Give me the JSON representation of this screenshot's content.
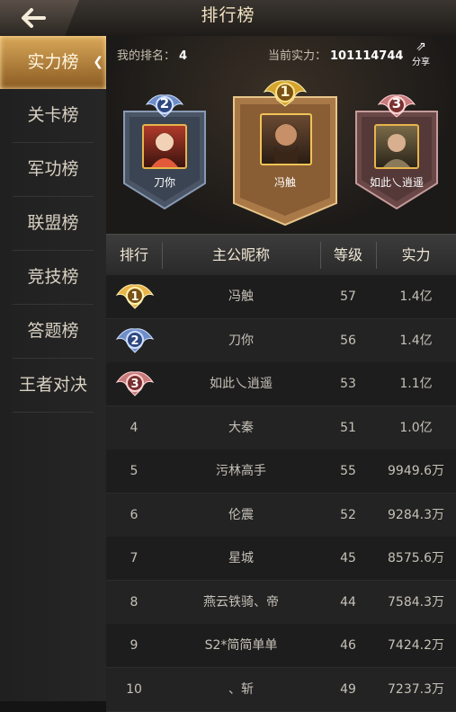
{
  "header": {
    "title": "排行榜"
  },
  "sidebar": {
    "items": [
      {
        "label": "实力榜",
        "active": true
      },
      {
        "label": "关卡榜",
        "active": false
      },
      {
        "label": "军功榜",
        "active": false
      },
      {
        "label": "联盟榜",
        "active": false
      },
      {
        "label": "竞技榜",
        "active": false
      },
      {
        "label": "答题榜",
        "active": false
      },
      {
        "label": "王者对决",
        "active": false
      }
    ]
  },
  "summary": {
    "my_rank_label": "我的排名：",
    "my_rank_value": "4",
    "power_label": "当前实力：",
    "power_value": "101114744",
    "share_label": "分享"
  },
  "podium": {
    "first": {
      "rank": "1",
      "name": "冯触"
    },
    "second": {
      "rank": "2",
      "name": "刀你"
    },
    "third": {
      "rank": "3",
      "name": "如此乀逍遥"
    }
  },
  "table": {
    "headers": {
      "rank": "排行",
      "name": "主公昵称",
      "level": "等级",
      "power": "实力"
    },
    "rows": [
      {
        "rank": "1",
        "name": "冯触",
        "level": "57",
        "power": "1.4亿"
      },
      {
        "rank": "2",
        "name": "刀你",
        "level": "56",
        "power": "1.4亿"
      },
      {
        "rank": "3",
        "name": "如此乀逍遥",
        "level": "53",
        "power": "1.1亿"
      },
      {
        "rank": "4",
        "name": "大秦",
        "level": "51",
        "power": "1.0亿"
      },
      {
        "rank": "5",
        "name": "污林高手",
        "level": "55",
        "power": "9949.6万"
      },
      {
        "rank": "6",
        "name": "伦震",
        "level": "52",
        "power": "9284.3万"
      },
      {
        "rank": "7",
        "name": "星城",
        "level": "45",
        "power": "8575.6万"
      },
      {
        "rank": "8",
        "name": "燕云铁骑、帝",
        "level": "44",
        "power": "7584.3万"
      },
      {
        "rank": "9",
        "name": "S2*简简单单",
        "level": "46",
        "power": "7424.2万"
      },
      {
        "rank": "10",
        "name": "、斩",
        "level": "49",
        "power": "7237.3万"
      }
    ]
  },
  "colors": {
    "gold": "#e7b44a",
    "silver": "#6f8ec8",
    "bronze": "#c97a7a",
    "accent": "#d9a85a"
  }
}
